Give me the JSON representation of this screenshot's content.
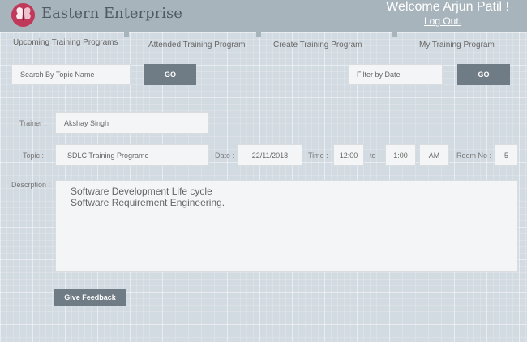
{
  "header": {
    "brand": "Eastern Enterprise",
    "welcome": "Welcome Arjun Patil !",
    "logout": "Log Out.",
    "logo_icon": "butterfly-logo-icon",
    "colors": {
      "bar": "#a8b4bc",
      "logo": "#c0395a"
    }
  },
  "tabs": [
    {
      "label": "Upcoming Training Programs"
    },
    {
      "label": "Attended Training Program"
    },
    {
      "label": "Create Training Program"
    },
    {
      "label": "My Training Program"
    }
  ],
  "search": {
    "topic_placeholder": "Search By Topic Name",
    "topic_go": "GO",
    "date_placeholder": "Filter by Date",
    "date_go": "GO"
  },
  "form": {
    "trainer_label": "Trainer :",
    "trainer_value": "Akshay Singh",
    "topic_label": "Topic :",
    "topic_value": "SDLC Training Programe",
    "date_label": "Date :",
    "date_value": "22/11/2018",
    "time_label": "Time :",
    "time_from": "12:00",
    "to_label": "to",
    "time_to": "1:00",
    "ampm": "AM",
    "room_label": "Room No :",
    "room_value": "5",
    "description_label": "Descrption :",
    "description_lines": [
      "Software Development Life cycle",
      "Software Requirement Engineering."
    ],
    "feedback_button": "Give Feedback"
  }
}
